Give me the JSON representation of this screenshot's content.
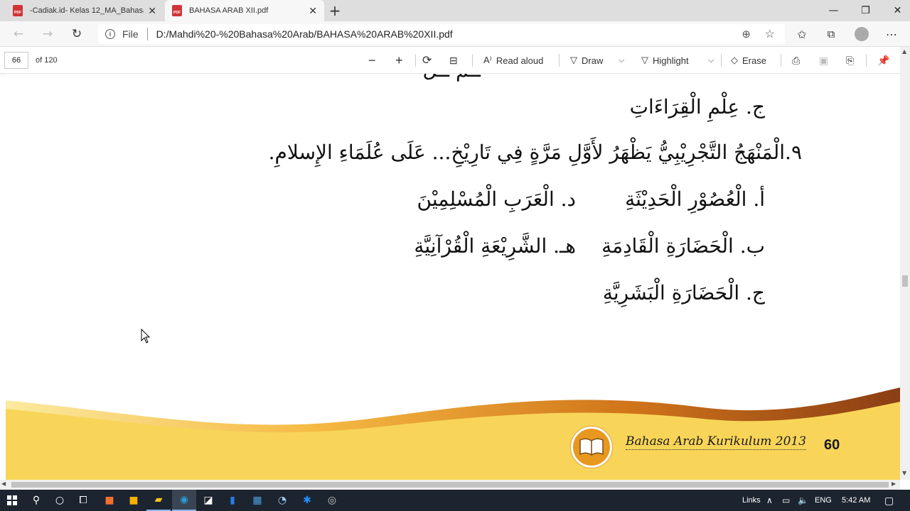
{
  "tabs": [
    {
      "title": "-Cadiak.id- Kelas 12_MA_Bahasa",
      "icon": "pdf-icon",
      "active": false
    },
    {
      "title": "BAHASA ARAB XII.pdf",
      "icon": "pdf-icon",
      "active": true
    }
  ],
  "tab_icon_label": "PDF",
  "address": {
    "scheme_label": "File",
    "url": "D:/Mahdi%20-%20Bahasa%20Arab/BAHASA%20ARAB%20XII.pdf"
  },
  "pdf_toolbar": {
    "page_current": "66",
    "page_total": "of 120",
    "read_aloud": "Read aloud",
    "draw": "Draw",
    "highlight": "Highlight",
    "erase": "Erase"
  },
  "document": {
    "option_j_prev": "ج. عِلْمِ الْقِرَاءَاتِ",
    "question": "٩.الْمَنْهَجُ التَّجْرِيْبِيُّ يَظْهَرُ لأَوَّلِ مَرَّةٍ فِي تَارِيْخِ... عَلَى عُلَمَاءِ الإِسلامِ.",
    "options": {
      "a": "أ. الْعُصُوْرِ الْحَدِيْثَةِ",
      "d": "د. الْعَرَبِ الْمُسْلِمِيْنَ",
      "b": "ب. الْحَضَارَةِ الْقَادِمَةِ",
      "h": "هـ. الشَّرِيْعَةِ الْقُرْآنِيَّةِ",
      "j": "ج. الْحَضَارَةِ الْبَشَرِيَّةِ"
    },
    "footer_title": "Bahasa Arab Kurikulum 2013",
    "page_number": "60"
  },
  "taskbar": {
    "links_label": "Links",
    "language": "ENG",
    "time": "5:42 AM"
  },
  "colors": {
    "footer_yellow": "#f8d558",
    "footer_orange": "#f0a020",
    "footer_brown": "#8a3e14",
    "taskbar": "#1c2430"
  }
}
